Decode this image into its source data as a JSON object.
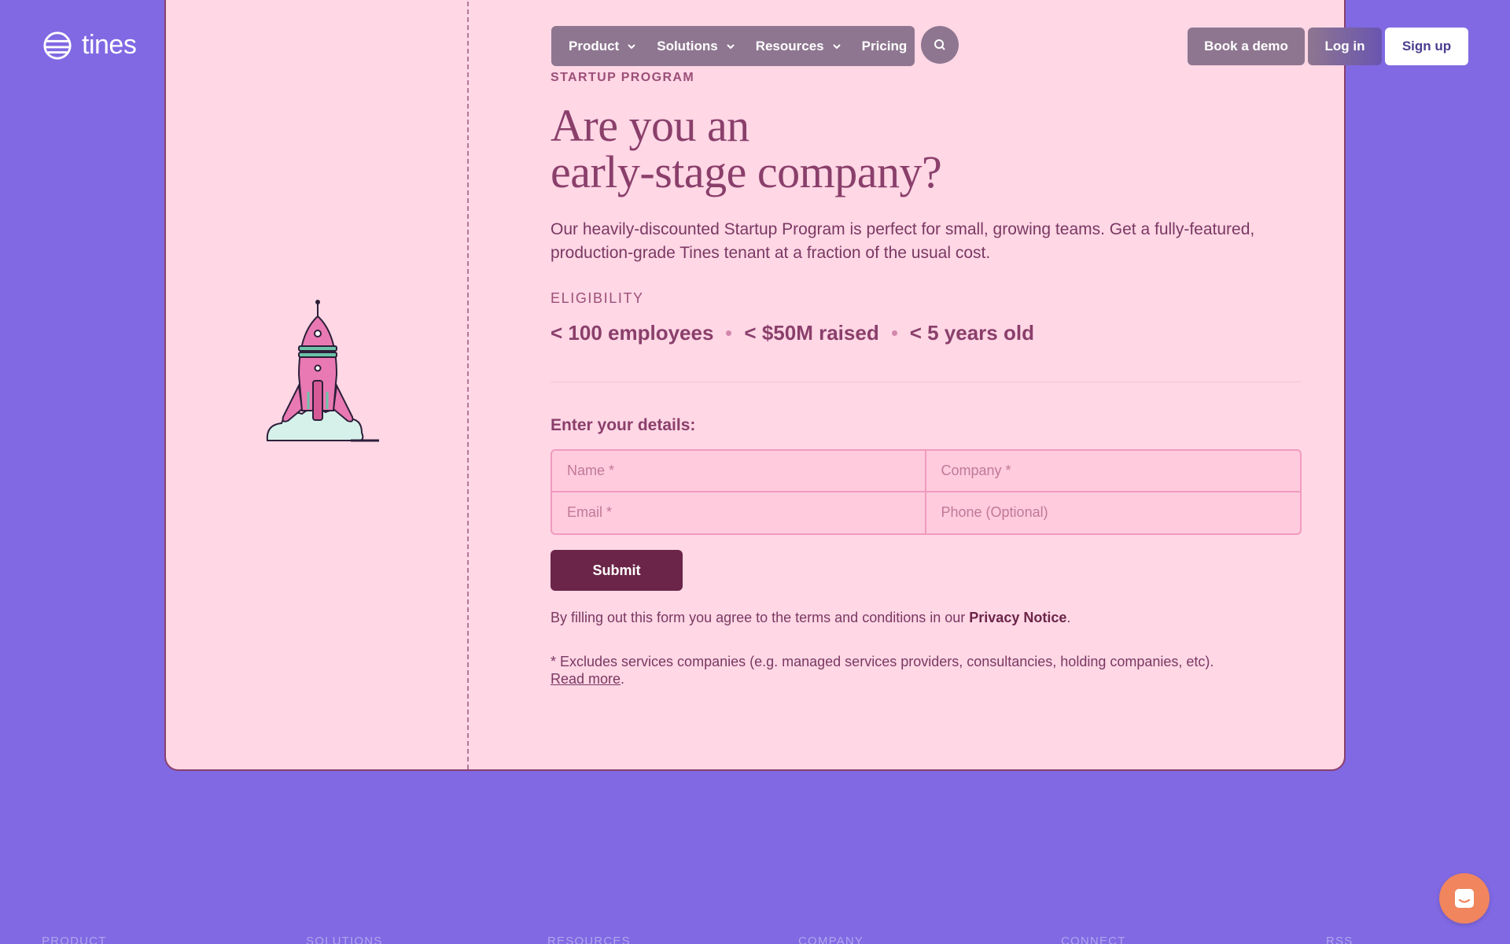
{
  "brand": {
    "name": "tines"
  },
  "nav": {
    "items": [
      {
        "label": "Product",
        "has_dropdown": true
      },
      {
        "label": "Solutions",
        "has_dropdown": true
      },
      {
        "label": "Resources",
        "has_dropdown": true
      },
      {
        "label": "Pricing",
        "has_dropdown": false
      }
    ],
    "search_icon": "search-icon"
  },
  "header_buttons": {
    "demo": "Book a demo",
    "login": "Log in",
    "signup": "Sign up"
  },
  "hero": {
    "eyebrow": "STARTUP PROGRAM",
    "headline_line1": "Are you an",
    "headline_line2": "early-stage company?",
    "intro": "Our heavily-discounted Startup Program is perfect for small, growing teams. Get a fully-featured, production-grade Tines tenant at a fraction of the usual cost."
  },
  "eligibility": {
    "label": "ELIGIBILITY",
    "criteria": [
      "< 100 employees",
      "< $50M raised",
      "< 5 years old"
    ]
  },
  "form": {
    "label": "Enter your details:",
    "name_placeholder": "Name *",
    "company_placeholder": "Company *",
    "email_placeholder": "Email *",
    "phone_placeholder": "Phone (Optional)",
    "submit": "Submit"
  },
  "terms": {
    "prefix": "By filling out this form you agree to the terms and conditions in our ",
    "link": "Privacy Notice",
    "suffix": "."
  },
  "exclusion": {
    "text": "* Excludes services companies (e.g. managed services providers, consultancies, holding companies, etc).",
    "link": "Read more",
    "suffix": "."
  },
  "footer": {
    "columns": [
      "PRODUCT",
      "SOLUTIONS",
      "RESOURCES",
      "COMPANY",
      "CONNECT",
      "RSS"
    ]
  },
  "colors": {
    "page_bg": "#8069e3",
    "card_bg": "#ffd7e5",
    "text": "#8a3f6b",
    "submit_bg": "#6b2548",
    "chat_bg": "#f0855e"
  }
}
